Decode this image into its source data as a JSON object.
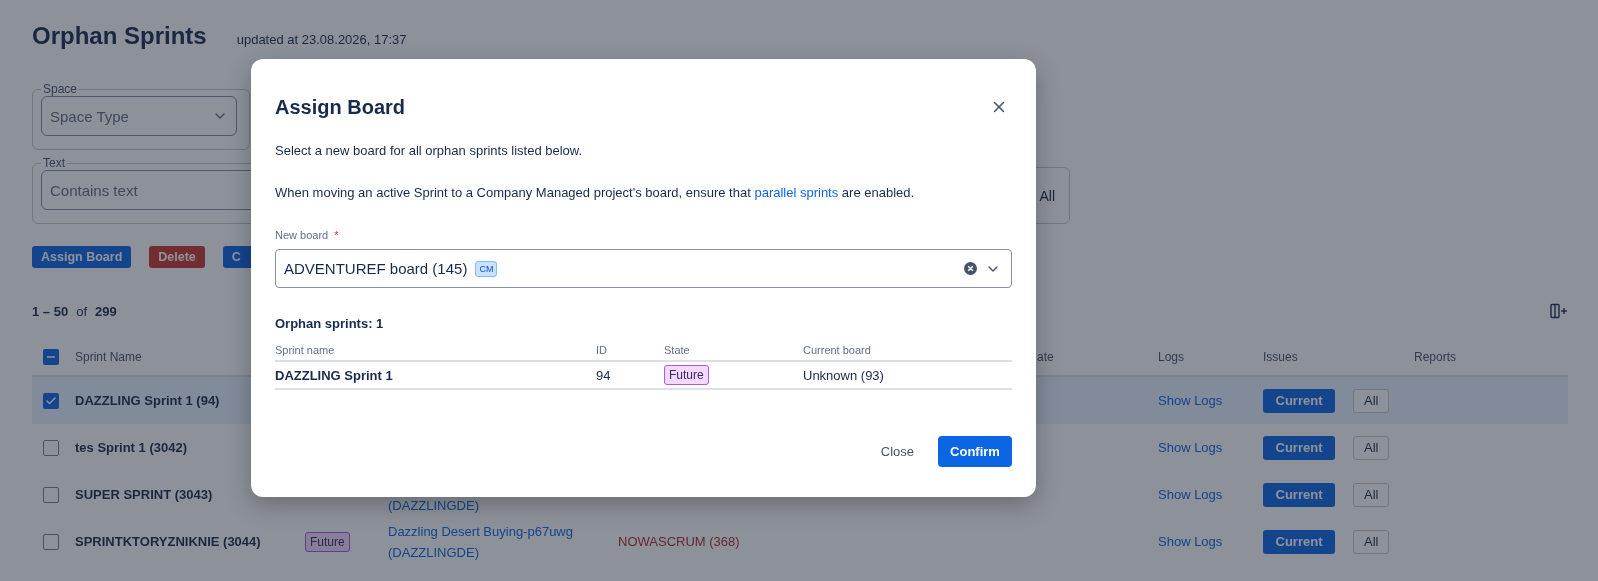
{
  "page": {
    "title": "Orphan Sprints",
    "updated": "updated at 23.08.2026, 17:37"
  },
  "filters": {
    "space": {
      "legend": "Space",
      "placeholder": "Space Type"
    },
    "text": {
      "legend": "Text",
      "placeholder": "Contains text"
    },
    "extra_option": "All"
  },
  "actions": [
    {
      "label": "Assign Board",
      "kind": "primary"
    },
    {
      "label": "Delete",
      "kind": "danger"
    },
    {
      "label": "C",
      "kind": "primary"
    }
  ],
  "pagination": {
    "range": "1 – 50",
    "of": "of",
    "total": "299"
  },
  "table": {
    "header_indeterminate": true,
    "columns": {
      "name": "Sprint Name",
      "date": "ate",
      "logs": "Logs",
      "issues": "Issues",
      "reports": "Reports"
    },
    "rows": [
      {
        "name": "DAZZLING Sprint 1 (94)",
        "selected": true,
        "logs": "Show Logs",
        "issues": [
          "Current",
          "All"
        ]
      },
      {
        "name": "tes Sprint 1 (3042)",
        "selected": false,
        "logs": "Show Logs",
        "issues": [
          "Current",
          "All"
        ]
      },
      {
        "name": "SUPER SPRINT (3043)",
        "selected": false,
        "space": [
          "(DAZZLINGDE)"
        ],
        "logs": "Show Logs",
        "issues": [
          "Current",
          "All"
        ]
      },
      {
        "name": "SPRINTKTORYZNIKNIE (3044)",
        "selected": false,
        "state": "Future",
        "space": [
          "Dazzling Desert Buying-p67uwg",
          "(DAZZLINGDE)"
        ],
        "board": "NOWASCRUM (368)",
        "logs": "Show Logs",
        "issues": [
          "Current",
          "All"
        ]
      }
    ]
  },
  "modal": {
    "title": "Assign Board",
    "intro": "Select a new board for all orphan sprints listed below.",
    "note": {
      "before": "When moving an active Sprint to a Company Managed project's board, ensure that ",
      "link": "parallel sprints",
      "after": " are enabled."
    },
    "field": {
      "label": "New board",
      "required_mark": "*",
      "value": "ADVENTUREF board (145)",
      "tag": "CM"
    },
    "list_title": "Orphan sprints: 1",
    "columns": [
      "Sprint name",
      "ID",
      "State",
      "Current board"
    ],
    "rows": [
      {
        "name": "DAZZLING Sprint 1",
        "id": "94",
        "state": "Future",
        "board": "Unknown (93)"
      }
    ],
    "buttons": [
      {
        "label": "Close",
        "kind": "subtle"
      },
      {
        "label": "Confirm",
        "kind": "primary"
      }
    ]
  }
}
